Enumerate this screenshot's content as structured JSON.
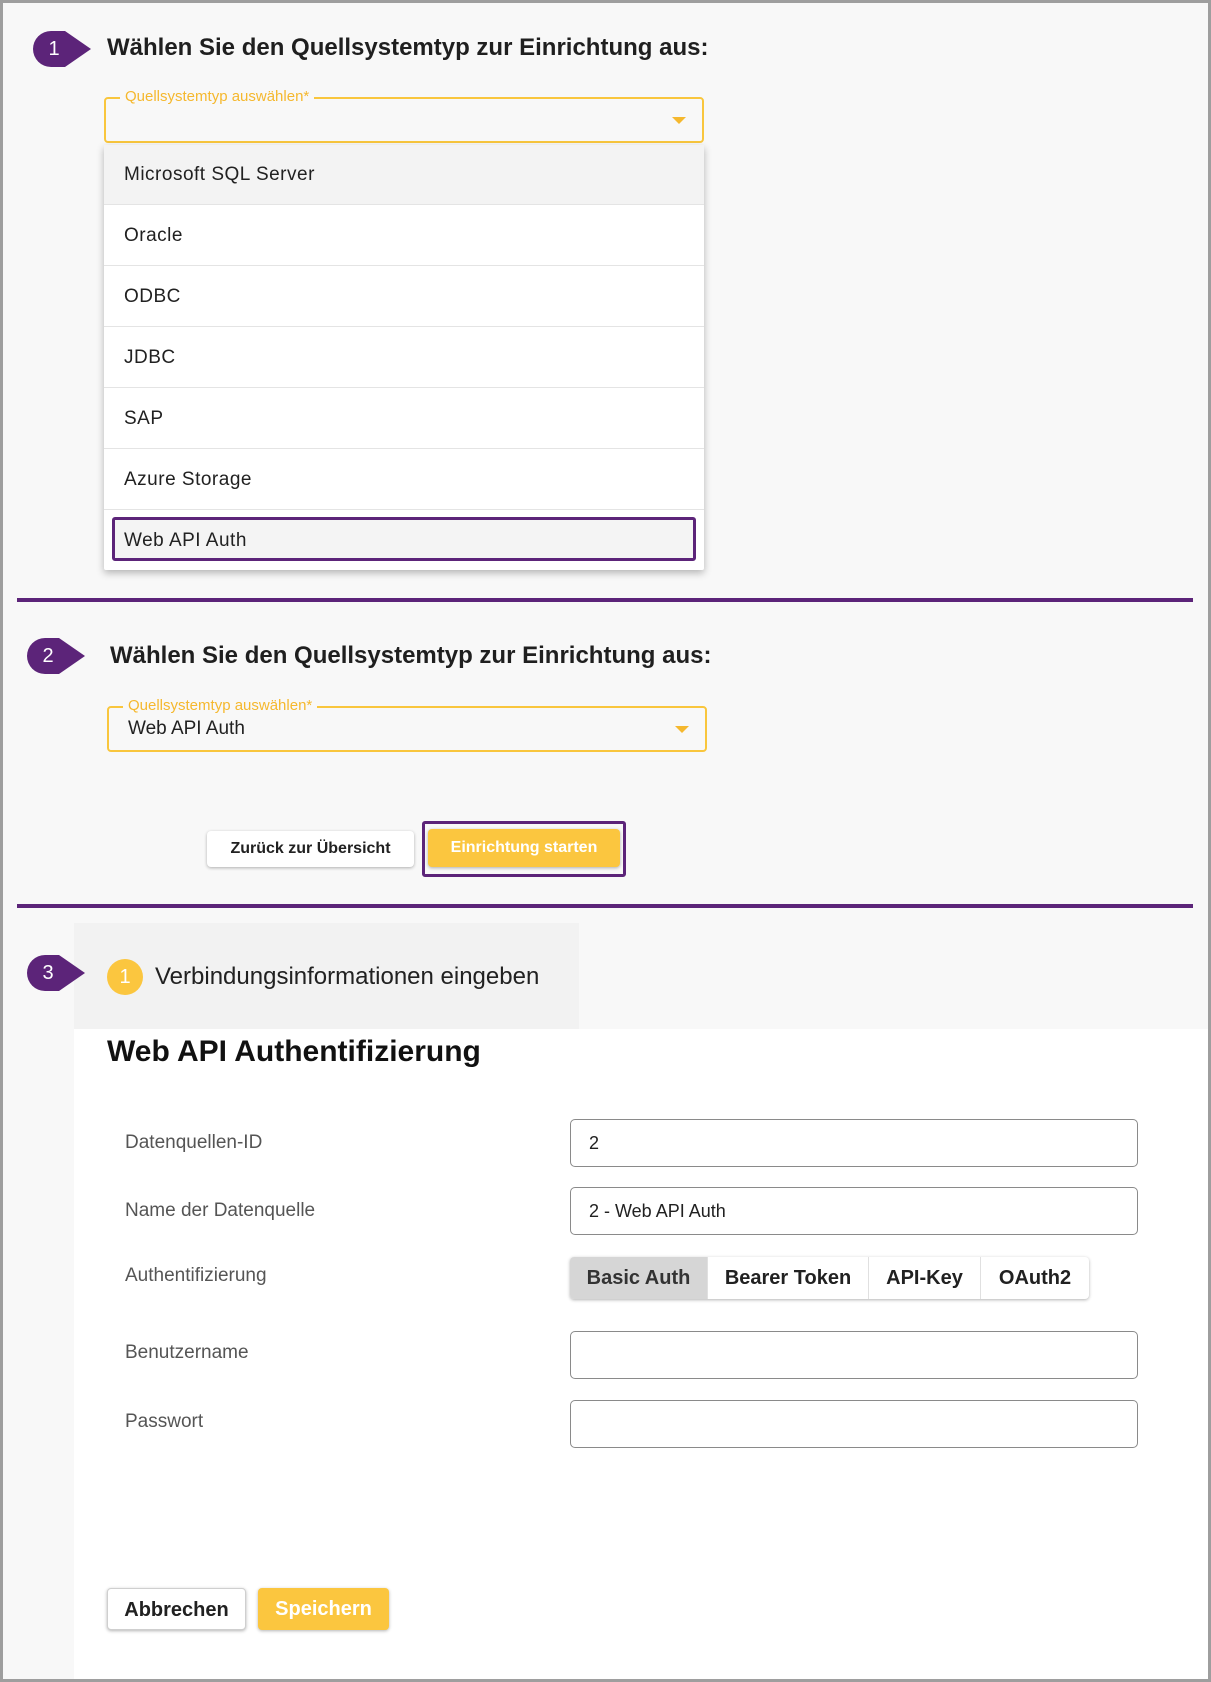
{
  "section1": {
    "marker": "1",
    "title": "Wählen Sie den Quellsystemtyp zur Einrichtung aus:",
    "select_label": "Quellsystemtyp auswählen*",
    "select_value": "",
    "options": [
      "Microsoft SQL Server",
      "Oracle",
      "ODBC",
      "JDBC",
      "SAP",
      "Azure Storage",
      "Web API Auth"
    ],
    "highlighted_option": "Web API Auth"
  },
  "section2": {
    "marker": "2",
    "title": "Wählen Sie den Quellsystemtyp zur Einrichtung aus:",
    "select_label": "Quellsystemtyp auswählen*",
    "select_value": "Web API Auth",
    "back_button": "Zurück zur Übersicht",
    "start_button": "Einrichtung starten"
  },
  "section3": {
    "marker": "3",
    "step_number": "1",
    "step_label": "Verbindungsinformationen eingeben",
    "form_title": "Web API Authentifizierung",
    "fields": {
      "id_label": "Datenquellen-ID",
      "id_value": "2",
      "name_label": "Name der Datenquelle",
      "name_value": "2 - Web API Auth",
      "auth_label": "Authentifizierung",
      "auth_options": [
        "Basic Auth",
        "Bearer Token",
        "API-Key",
        "OAuth2"
      ],
      "auth_selected": "Basic Auth",
      "user_label": "Benutzername",
      "user_value": "",
      "password_label": "Passwort",
      "password_value": ""
    },
    "cancel_button": "Abbrechen",
    "save_button": "Speichern"
  },
  "colors": {
    "accent": "#fbc63f",
    "marker": "#5c2479",
    "highlight_border": "#5c2479"
  }
}
